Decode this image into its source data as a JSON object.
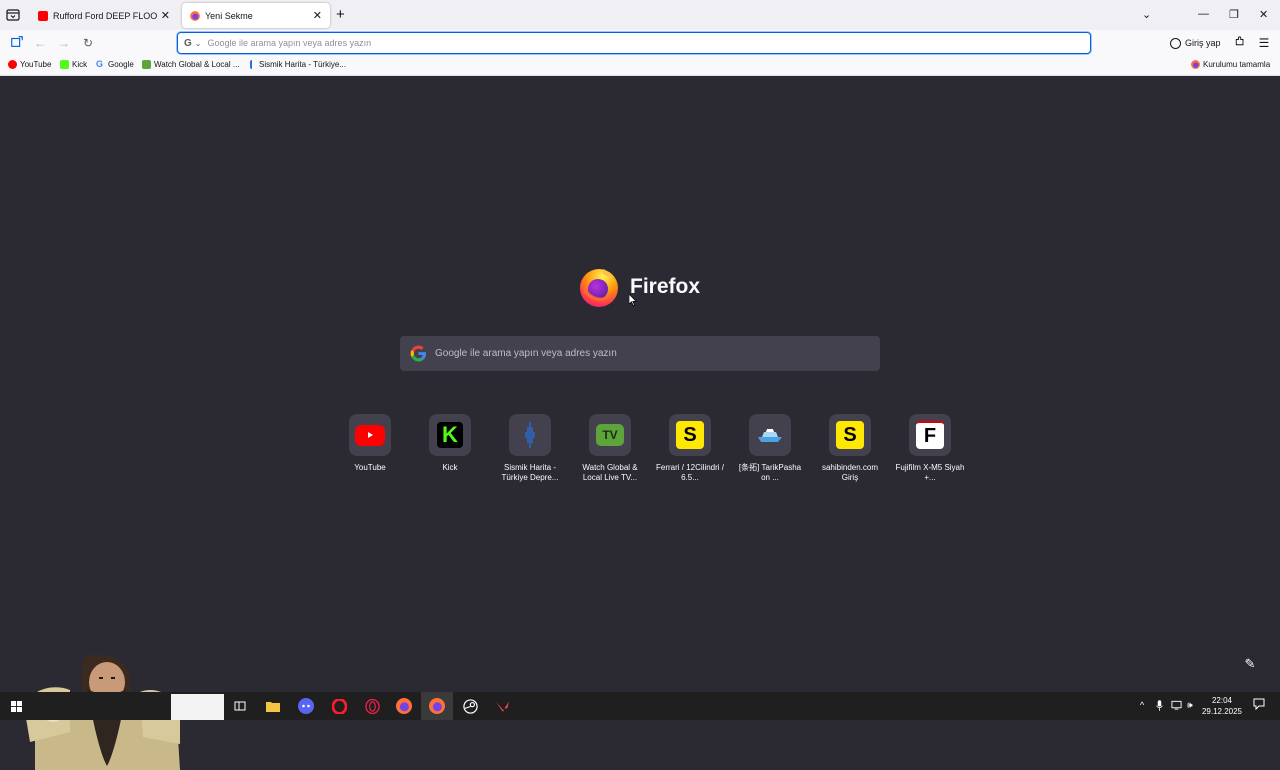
{
  "tabs": [
    {
      "title": "Rufford Ford DEEP FLOOD | pa",
      "favicon": "youtube-icon",
      "active": false
    },
    {
      "title": "Yeni Sekme",
      "favicon": "firefox-icon",
      "active": true
    }
  ],
  "window_controls": {
    "minimize": "—",
    "maximize": "❐",
    "close": "✕"
  },
  "urlbar": {
    "placeholder": "Google ile arama yapın veya adres yazın",
    "value": "",
    "engine": "G"
  },
  "signin_label": "Giriş yap",
  "bookmarks": [
    {
      "label": "YouTube",
      "icon": "youtube-icon",
      "color": "#ff0000"
    },
    {
      "label": "Kick",
      "icon": "kick-icon",
      "color": "#53fc18"
    },
    {
      "label": "Google",
      "icon": "google-icon",
      "color": "#4285f4"
    },
    {
      "label": "Watch Global & Local ...",
      "icon": "tv-icon",
      "color": "#5da43b"
    },
    {
      "label": "Sismik Harita - Türkiye...",
      "icon": "seismic-icon",
      "color": "#2a6fdb"
    }
  ],
  "bookmark_right": {
    "label": "Kurulumu tamamla",
    "icon": "firefox-icon"
  },
  "newtab": {
    "brand": "Firefox",
    "search_placeholder": "Google ile arama yapın veya adres yazın",
    "top_sites": [
      {
        "label": "YouTube",
        "icon": "youtube-icon",
        "color": "#ff0000"
      },
      {
        "label": "Kick",
        "icon": "kick-icon",
        "color": "#53fc18"
      },
      {
        "label": "Sismik Harita - Türkiye Depre...",
        "icon": "seismic-icon",
        "color": "#2a6fdb"
      },
      {
        "label": "Watch Global & Local Live TV...",
        "icon": "tv-icon",
        "color": "#5da43b"
      },
      {
        "label": "Ferrari / 12Cilindri / 6.5...",
        "icon": "sahibinden-icon",
        "color": "#ffe800"
      },
      {
        "label": "[条拓] TarikPasha on ...",
        "icon": "ship-icon",
        "color": "#4aa3df"
      },
      {
        "label": "sahibinden.com Giriş",
        "icon": "sahibinden-icon",
        "color": "#ffe800"
      },
      {
        "label": "Fujifilm X-M5 Siyah +...",
        "icon": "f-letter-icon",
        "color": "#ffffff"
      }
    ]
  },
  "taskbar": {
    "clock_time": "22:04",
    "clock_date": "29.12.2025",
    "apps": [
      "start-icon",
      "task-view-icon",
      "file-explorer-icon",
      "discord-icon",
      "opera-icon",
      "opera-gx-icon",
      "firefox-icon",
      "firefox-active-icon",
      "steam-icon",
      "valorant-icon"
    ]
  }
}
